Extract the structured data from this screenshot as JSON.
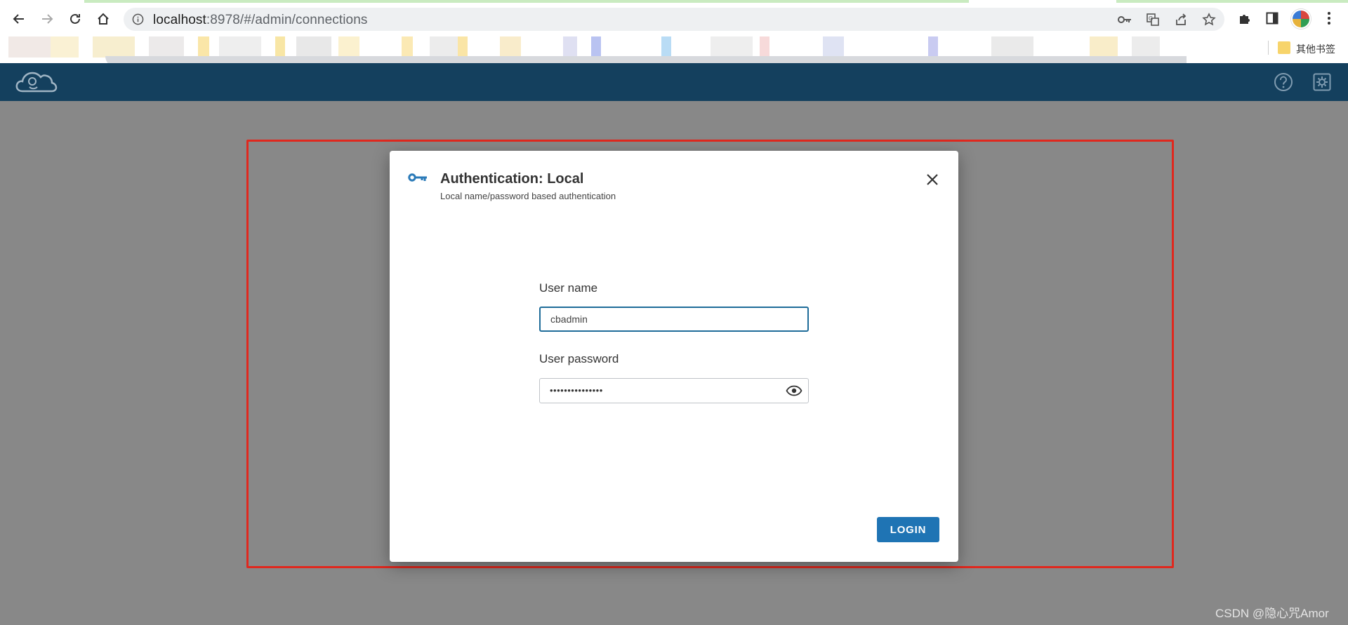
{
  "browser": {
    "url_host": "localhost",
    "url_path": ":8978/#/admin/connections",
    "bookmarks_other": "其他书签"
  },
  "icons": {
    "back": "arrow-left-icon",
    "forward": "arrow-right-icon",
    "reload": "reload-icon",
    "home": "home-icon",
    "site_info": "info-icon",
    "password_key": "key-icon",
    "translate": "translate-icon",
    "share": "share-icon",
    "bookmark": "star-icon",
    "extensions": "puzzle-icon",
    "side_panel": "side-panel-icon",
    "menu": "more-vert-icon",
    "app_logo": "cloudbeaver-logo",
    "help": "help-icon",
    "settings": "gear-icon",
    "dialog_key": "key-icon",
    "close": "close-icon",
    "show_password": "eye-icon"
  },
  "colors": {
    "header": "#14405e",
    "overlay": "#888888",
    "primary_button": "#1f74b4",
    "focus_border": "#1e6c99",
    "annotation": "#e0281e"
  },
  "dialog": {
    "title": "Authentication: Local",
    "subtitle": "Local name/password based authentication",
    "username_label": "User name",
    "username_value": "cbadmin",
    "password_label": "User password",
    "password_masked": "•••••••••••••••",
    "login_label": "LOGIN"
  },
  "watermark": "CSDN @隐心咒Amor"
}
